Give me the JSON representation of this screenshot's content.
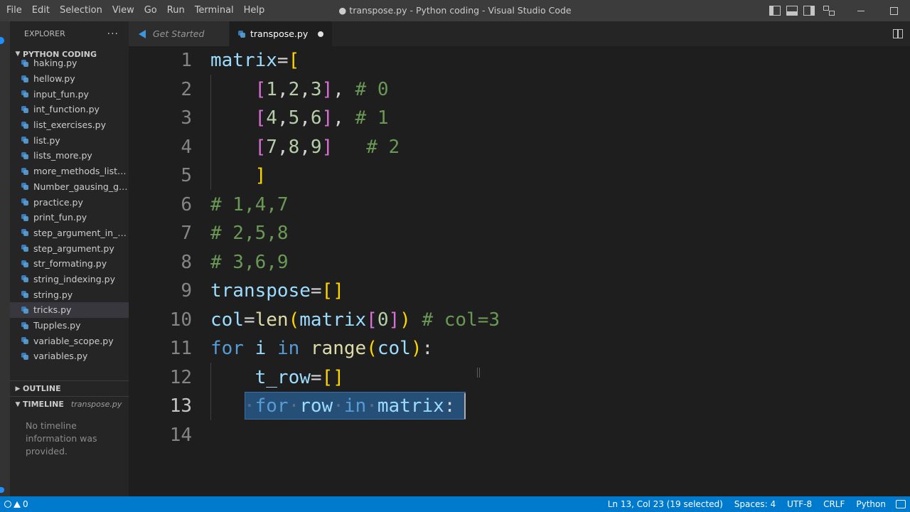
{
  "window": {
    "title": "● transpose.py - Python coding - Visual Studio Code"
  },
  "menu": [
    "File",
    "Edit",
    "Selection",
    "View",
    "Go",
    "Run",
    "Terminal",
    "Help"
  ],
  "sidebar": {
    "header": "EXPLORER",
    "more": "···",
    "folder": "PYTHON CODING",
    "files": [
      "haking.py",
      "hellow.py",
      "input_fun.py",
      "int_function.py",
      "list_exercises.py",
      "list.py",
      "lists_more.py",
      "more_methods_list.py",
      "Number_gausing_ga...",
      "practice.py",
      "print_fun.py",
      "step_argument_in_ran...",
      "step_argument.py",
      "str_formating.py",
      "string_indexing.py",
      "string.py",
      "tricks.py",
      "Tupples.py",
      "variable_scope.py",
      "variables.py"
    ],
    "selected_file": "tricks.py",
    "outline": "OUTLINE",
    "timeline": "TIMELINE",
    "timeline_file": "transpose.py",
    "timeline_message": "No timeline information was provided."
  },
  "tabs": [
    {
      "label": "Get Started",
      "active": false
    },
    {
      "label": "transpose.py",
      "active": true,
      "dirty": true
    }
  ],
  "editor": {
    "lines": [
      {
        "n": "1",
        "code": "matrix=["
      },
      {
        "n": "2",
        "code": "    [1,2,3], # 0"
      },
      {
        "n": "3",
        "code": "    [4,5,6], # 1"
      },
      {
        "n": "4",
        "code": "    [7,8,9]   # 2"
      },
      {
        "n": "5",
        "code": "    ]"
      },
      {
        "n": "6",
        "code": "# 1,4,7"
      },
      {
        "n": "7",
        "code": "# 2,5,8"
      },
      {
        "n": "8",
        "code": "# 3,6,9"
      },
      {
        "n": "9",
        "code": "transpose=[]"
      },
      {
        "n": "10",
        "code": "col=len(matrix[0]) # col=3"
      },
      {
        "n": "11",
        "code": "for i in range(col):"
      },
      {
        "n": "12",
        "code": "    t_row=[]"
      },
      {
        "n": "13",
        "code": "    for row in matrix:"
      },
      {
        "n": "14",
        "code": ""
      }
    ],
    "current_line": "13"
  },
  "status": {
    "errors": "0",
    "warnings": "0",
    "position": "Ln 13, Col 23 (19 selected)",
    "spaces": "Spaces: 4",
    "encoding": "UTF-8",
    "eol": "CRLF",
    "language": "Python"
  },
  "colors": {
    "statusbar": "#007acc",
    "editor_bg": "#1e1e1e",
    "sidebar_bg": "#252526",
    "selection": "#264f78"
  }
}
